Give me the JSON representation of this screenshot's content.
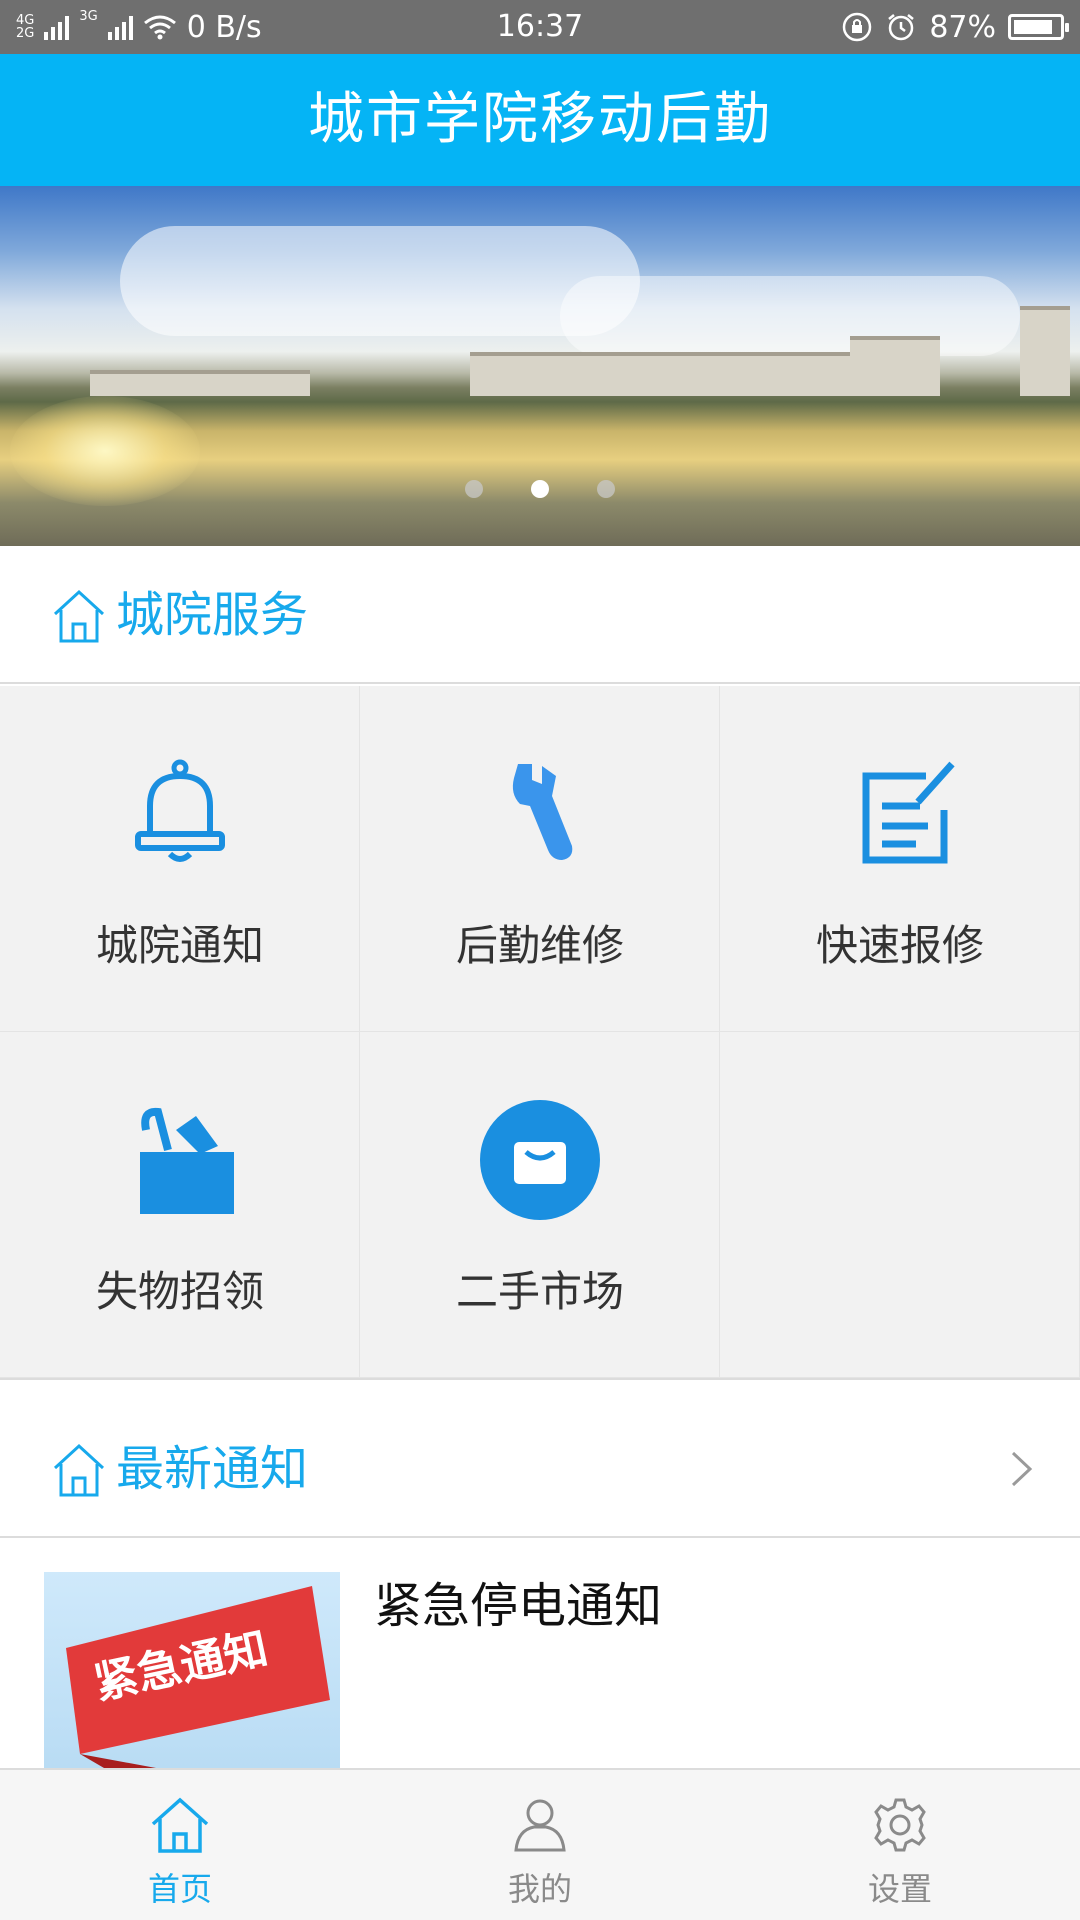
{
  "status_bar": {
    "network_top": "4G",
    "network_bottom": "2G",
    "network_second": "3G",
    "speed": "0 B/s",
    "time": "16:37",
    "battery": "87%",
    "battery_level": 0.87
  },
  "header": {
    "title": "城市学院移动后勤"
  },
  "banner": {
    "slide_count": 3,
    "active_slide": 2
  },
  "services": {
    "title": "城院服务",
    "items": [
      {
        "label": "城院通知",
        "icon": "bell-icon"
      },
      {
        "label": "后勤维修",
        "icon": "wrench-icon"
      },
      {
        "label": "快速报修",
        "icon": "edit-note-icon"
      },
      {
        "label": "失物招领",
        "icon": "lost-found-box-icon"
      },
      {
        "label": "二手市场",
        "icon": "shopping-bag-icon"
      }
    ]
  },
  "notices": {
    "title": "最新通知",
    "items": [
      {
        "title": "紧急停电通知",
        "thumb_text": "紧急通知"
      }
    ]
  },
  "tabs": [
    {
      "label": "首页",
      "icon": "home-icon",
      "active": true
    },
    {
      "label": "我的",
      "icon": "user-icon",
      "active": false
    },
    {
      "label": "设置",
      "icon": "gear-icon",
      "active": false
    }
  ],
  "colors": {
    "accent": "#05b4f5",
    "accent_text": "#17a9ec",
    "icon_blue": "#1a8fe0"
  }
}
